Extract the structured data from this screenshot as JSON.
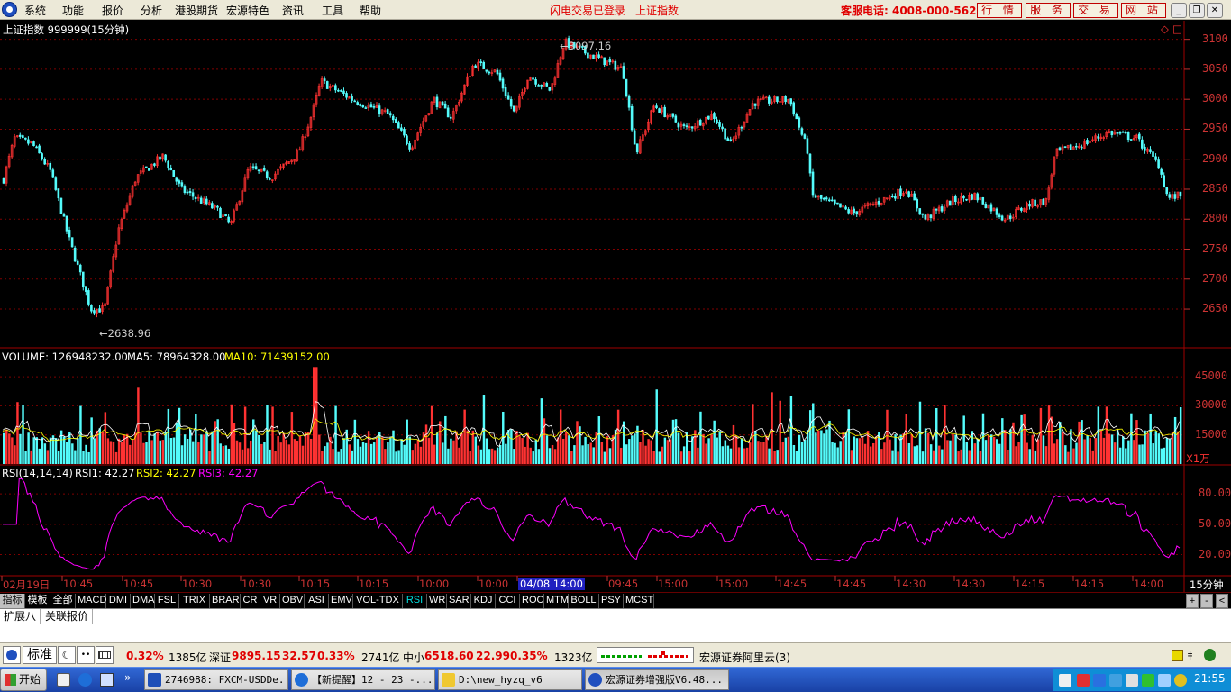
{
  "menubar": {
    "items": [
      "系统",
      "功能",
      "报价",
      "分析",
      "港股期货",
      "宏源特色",
      "资讯",
      "工具",
      "帮助"
    ],
    "status_login": "闪电交易已登录",
    "status_index": "上证指数",
    "hotline": "客服电话: 4008-000-562",
    "buttons": [
      "行 情",
      "服 务",
      "交 易",
      "网 站"
    ],
    "win_controls": [
      "_",
      "❐",
      "✕"
    ]
  },
  "price_panel": {
    "title": "上证指数 999999(15分钟)",
    "high_label": "3097.16",
    "low_label": "2638.96",
    "y_ticks": [
      "3100",
      "3050",
      "3000",
      "2950",
      "2900",
      "2850",
      "2800",
      "2750",
      "2700",
      "2650"
    ],
    "corner_icons": [
      "◇",
      "□"
    ]
  },
  "volume_panel": {
    "label": "VOLUME: 126948232.00",
    "ma5": "MA5: 78964328.00",
    "ma10": "MA10: 71439152.00",
    "y_ticks": [
      "45000",
      "30000",
      "15000"
    ],
    "unit": "X1万"
  },
  "rsi_panel": {
    "label": "RSI(14,14,14)",
    "rsi1": "RSI1: 42.27",
    "rsi2": "RSI2: 42.27",
    "rsi3": "RSI3: 42.27",
    "y_ticks": [
      "80.00",
      "50.00",
      "20.00"
    ]
  },
  "time_axis": {
    "labels": [
      "02月19日",
      "10:45",
      "10:45",
      "10:30",
      "10:30",
      "10:15",
      "10:15",
      "10:00",
      "10:00",
      "04/08 14:00",
      "09:45",
      "15:00",
      "15:00",
      "14:45",
      "14:45",
      "14:30",
      "14:30",
      "14:15",
      "14:15",
      "14:00"
    ],
    "period": "15分钟"
  },
  "indicator_tabs": [
    "指标",
    "模板",
    "全部",
    "MACD",
    "DMI",
    "DMA",
    "FSL",
    "TRIX",
    "BRAR",
    "CR",
    "VR",
    "OBV",
    "ASI",
    "EMV",
    "VOL-TDX",
    "RSI",
    "WR",
    "SAR",
    "KDJ",
    "CCI",
    "ROC",
    "MTM",
    "BOLL",
    "PSY",
    "MCST"
  ],
  "active_indicator": "RSI",
  "indicator_side": [
    "+",
    "-",
    "<"
  ],
  "ext_tabs": [
    "扩展八",
    "关联报价"
  ],
  "statusbar": {
    "mode": "标准",
    "sh_change_pct": "0.32%",
    "sh_amount": "1385亿",
    "sz_name": "深证",
    "sz_value": "9895.15",
    "sz_change": "32.57",
    "sz_change_pct": "0.33%",
    "sz_amount": "2741亿",
    "sme_name": "中小",
    "sme_value": "6518.60",
    "sme_change": "22.99",
    "sme_change_pct": "0.35%",
    "sme_amount": "1323亿",
    "server": "宏源证券阿里云(3)"
  },
  "taskbar": {
    "start": "开始",
    "tasks": [
      "2746988: FXCM-USDDe...",
      "【新提醒】12 - 23 -...",
      "D:\\new_hyzq_v6",
      "宏源证券增强版V6.48..."
    ],
    "clock": "21:55"
  },
  "colors": {
    "up": "#ff3232",
    "down": "#54fcfc",
    "ma5": "#ffffff",
    "ma10": "#ffff00",
    "rsi": "#ff00ff",
    "grid": "#800000"
  },
  "chart_data": {
    "type": "candlestick",
    "title": "上证指数 999999(15分钟)",
    "y_range": [
      2620,
      3110
    ],
    "anchors": [
      [
        0,
        2850
      ],
      [
        15,
        2935
      ],
      [
        35,
        2925
      ],
      [
        55,
        2880
      ],
      [
        75,
        2770
      ],
      [
        100,
        2650
      ],
      [
        115,
        2650
      ],
      [
        130,
        2780
      ],
      [
        150,
        2870
      ],
      [
        180,
        2905
      ],
      [
        200,
        2850
      ],
      [
        240,
        2815
      ],
      [
        255,
        2790
      ],
      [
        275,
        2885
      ],
      [
        300,
        2870
      ],
      [
        330,
        2910
      ],
      [
        345,
        2975
      ],
      [
        355,
        3030
      ],
      [
        390,
        3000
      ],
      [
        430,
        2975
      ],
      [
        455,
        2920
      ],
      [
        480,
        3000
      ],
      [
        500,
        2970
      ],
      [
        525,
        3060
      ],
      [
        550,
        3045
      ],
      [
        570,
        2975
      ],
      [
        585,
        3040
      ],
      [
        610,
        3015
      ],
      [
        625,
        3095
      ],
      [
        660,
        3070
      ],
      [
        690,
        3050
      ],
      [
        705,
        2910
      ],
      [
        725,
        2990
      ],
      [
        760,
        2950
      ],
      [
        790,
        2975
      ],
      [
        810,
        2925
      ],
      [
        835,
        2995
      ],
      [
        875,
        3000
      ],
      [
        895,
        2915
      ],
      [
        900,
        2840
      ],
      [
        915,
        2830
      ],
      [
        945,
        2810
      ],
      [
        975,
        2830
      ],
      [
        1005,
        2850
      ],
      [
        1025,
        2800
      ],
      [
        1055,
        2830
      ],
      [
        1080,
        2840
      ],
      [
        1115,
        2800
      ],
      [
        1140,
        2825
      ],
      [
        1160,
        2830
      ],
      [
        1170,
        2910
      ],
      [
        1200,
        2925
      ],
      [
        1230,
        2945
      ],
      [
        1260,
        2935
      ],
      [
        1285,
        2890
      ],
      [
        1295,
        2835
      ],
      [
        1310,
        2840
      ]
    ]
  }
}
